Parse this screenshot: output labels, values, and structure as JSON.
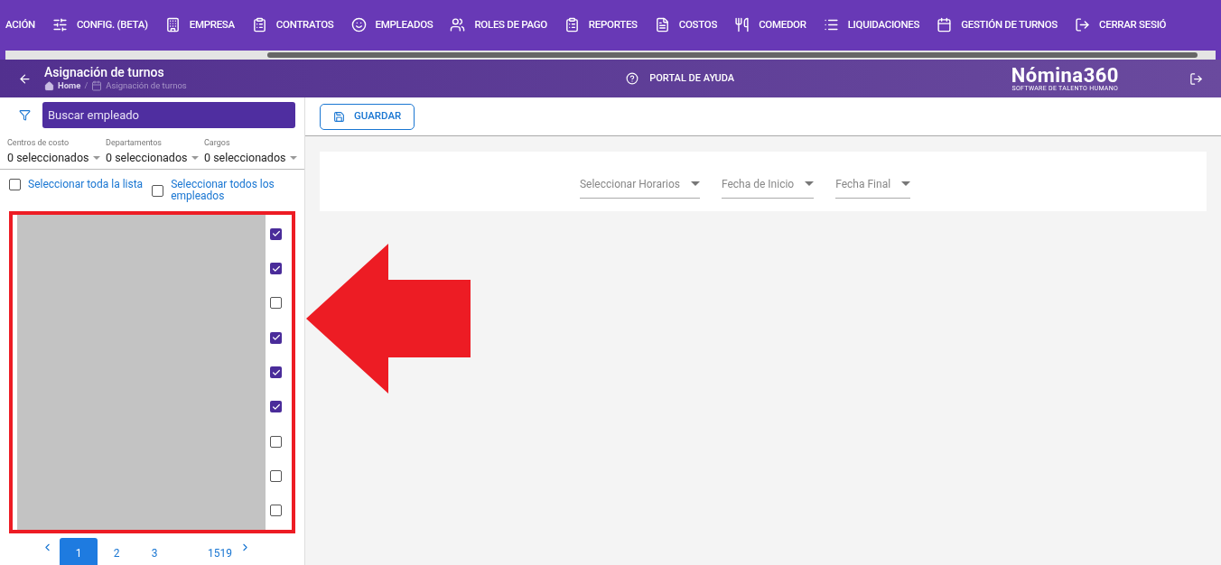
{
  "nav": [
    {
      "label": "ACIÓN"
    },
    {
      "label": "CONFIG. (BETA)"
    },
    {
      "label": "EMPRESA"
    },
    {
      "label": "CONTRATOS"
    },
    {
      "label": "EMPLEADOS"
    },
    {
      "label": "ROLES DE PAGO"
    },
    {
      "label": "REPORTES"
    },
    {
      "label": "COSTOS"
    },
    {
      "label": "COMEDOR"
    },
    {
      "label": "LIQUIDACIONES"
    },
    {
      "label": "GESTIÓN DE TURNOS"
    },
    {
      "label": "CERRAR SESIÓ"
    }
  ],
  "header": {
    "title": "Asignación de turnos",
    "breadcrumb": [
      "Home",
      "/",
      "Asignación de turnos"
    ],
    "help": "PORTAL DE AYUDA",
    "logo": "Nómina360",
    "tagline": "SOFTWARE DE TALENTO HUMANO"
  },
  "search": {
    "placeholder": "Buscar empleado"
  },
  "filters": [
    {
      "label": "Centros de costo",
      "value": "0 seleccionados"
    },
    {
      "label": "Departamentos",
      "value": "0 seleccionados"
    },
    {
      "label": "Cargos",
      "value": "0 seleccionados"
    }
  ],
  "select_all": [
    {
      "label": "Seleccionar toda la lista",
      "checked": false
    },
    {
      "label": "Seleccionar todos los empleados",
      "checked": false
    }
  ],
  "employees": [
    {
      "checked": true
    },
    {
      "checked": true
    },
    {
      "checked": false
    },
    {
      "checked": true
    },
    {
      "checked": true
    },
    {
      "checked": true
    },
    {
      "checked": false
    },
    {
      "checked": false
    },
    {
      "checked": false
    }
  ],
  "pagination": [
    {
      "label": "1",
      "selected": true
    },
    {
      "label": "2",
      "selected": false
    },
    {
      "label": "3",
      "selected": false
    },
    {
      "label": "1519",
      "selected": false
    }
  ],
  "save_button": "GUARDAR",
  "selectors": [
    {
      "label": "Seleccionar Horarios"
    },
    {
      "label": "Fecha de Inicio"
    },
    {
      "label": "Fecha Final"
    }
  ]
}
